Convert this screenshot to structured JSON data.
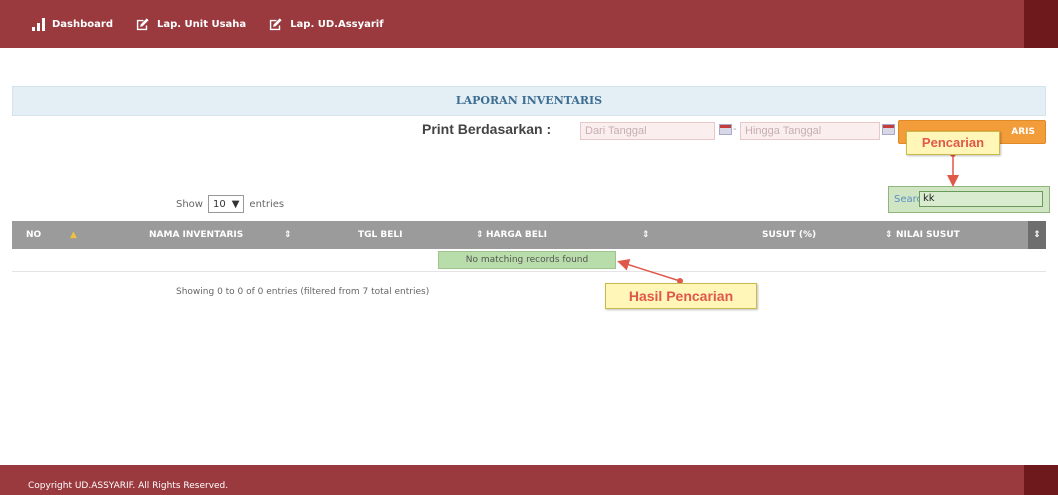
{
  "nav": {
    "items": [
      {
        "label": "Dashboard",
        "icon": "bar-chart-icon"
      },
      {
        "label": "Lap. Unit Usaha",
        "icon": "edit-icon"
      },
      {
        "label": "Lap. UD.Assyarif",
        "icon": "edit-icon"
      }
    ]
  },
  "panel": {
    "title": "LAPORAN INVENTARIS"
  },
  "print": {
    "label": "Print Berdasarkan :",
    "from_placeholder": "Dari Tanggal",
    "separator": "-",
    "to_placeholder": "Hingga Tanggal",
    "button_label": "ARIS"
  },
  "annotations": {
    "pencarian": "Pencarian",
    "hasil": "Hasil Pencarian"
  },
  "length": {
    "prefix": "Show",
    "value": "10",
    "suffix": "entries"
  },
  "search": {
    "label": "Search:",
    "value": "kk"
  },
  "table": {
    "columns": [
      "NO",
      "NAMA INVENTARIS",
      "TGL BELI",
      "HARGA BELI",
      "SUSUT (%)",
      "NILAI SUSUT"
    ],
    "empty_message": "No matching records found",
    "info": "Showing 0 to 0 of 0 entries (filtered from 7 total entries)"
  },
  "footer": {
    "copyright": "Copyright UD.ASSYARIF. All Rights Reserved."
  },
  "colors": {
    "topbar": "#9a3a3f",
    "table_header": "#9b9b9b",
    "print_button": "#f29c3a",
    "callout_bg": "#fff6b8",
    "callout_text": "#e0584a"
  }
}
